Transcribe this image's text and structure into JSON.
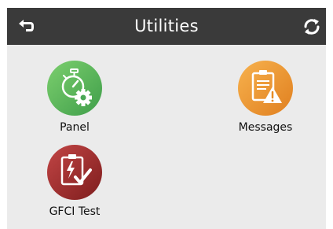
{
  "header": {
    "title": "Utilities",
    "back_icon": "back-arrow-icon",
    "refresh_icon": "refresh-icon"
  },
  "tiles": [
    {
      "label": "Panel",
      "icon": "stopwatch-gear-icon",
      "color": "#5cb85c"
    },
    {
      "label": "Messages",
      "icon": "clipboard-warning-icon",
      "color": "#f0962e"
    },
    {
      "label": "GFCI Test",
      "icon": "clipboard-lightning-check-icon",
      "color": "#9b2a2a"
    }
  ],
  "colors": {
    "header_bg": "#3a3a3a",
    "screen_bg": "#ebebeb"
  }
}
